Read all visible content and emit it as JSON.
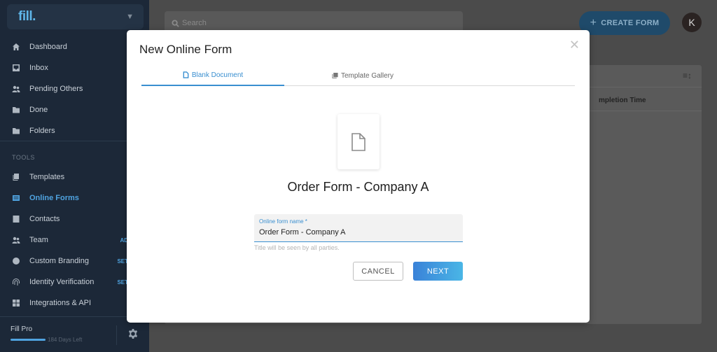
{
  "sidebar": {
    "logo": "fill.",
    "items": [
      {
        "label": "Dashboard",
        "icon": "home-icon"
      },
      {
        "label": "Inbox",
        "icon": "inbox-icon"
      },
      {
        "label": "Pending Others",
        "icon": "people-icon"
      },
      {
        "label": "Done",
        "icon": "folder-check-icon"
      },
      {
        "label": "Folders",
        "icon": "folder-icon"
      }
    ],
    "section_label": "TOOLS",
    "tools": [
      {
        "label": "Templates",
        "icon": "templates-icon",
        "badge": ""
      },
      {
        "label": "Online Forms",
        "icon": "forms-icon",
        "badge": "",
        "active": true
      },
      {
        "label": "Contacts",
        "icon": "contacts-icon",
        "badge": ""
      },
      {
        "label": "Team",
        "icon": "team-icon",
        "badge": "AD"
      },
      {
        "label": "Custom Branding",
        "icon": "palette-icon",
        "badge": "SET"
      },
      {
        "label": "Identity Verification",
        "icon": "fingerprint-icon",
        "badge": "SET"
      },
      {
        "label": "Integrations & API",
        "icon": "grid-icon",
        "badge": ""
      }
    ],
    "plan": "Fill Pro",
    "days_left": "184 Days Left"
  },
  "header": {
    "search_placeholder": "Search",
    "create_button": "CREATE FORM",
    "avatar_initial": "K"
  },
  "table": {
    "column_partial": "mpletion Time"
  },
  "modal": {
    "title": "New Online Form",
    "tabs": [
      {
        "label": "Blank Document",
        "active": true
      },
      {
        "label": "Template Gallery",
        "active": false
      }
    ],
    "document_name": "Order Form - Company A",
    "field_label": "Online form name *",
    "field_value": "Order Form - Company A",
    "hint": "Title will be seen by all parties.",
    "cancel_label": "CANCEL",
    "next_label": "NEXT"
  },
  "colors": {
    "accent": "#3a8fd0",
    "sidebar_bg": "#1c2838"
  }
}
